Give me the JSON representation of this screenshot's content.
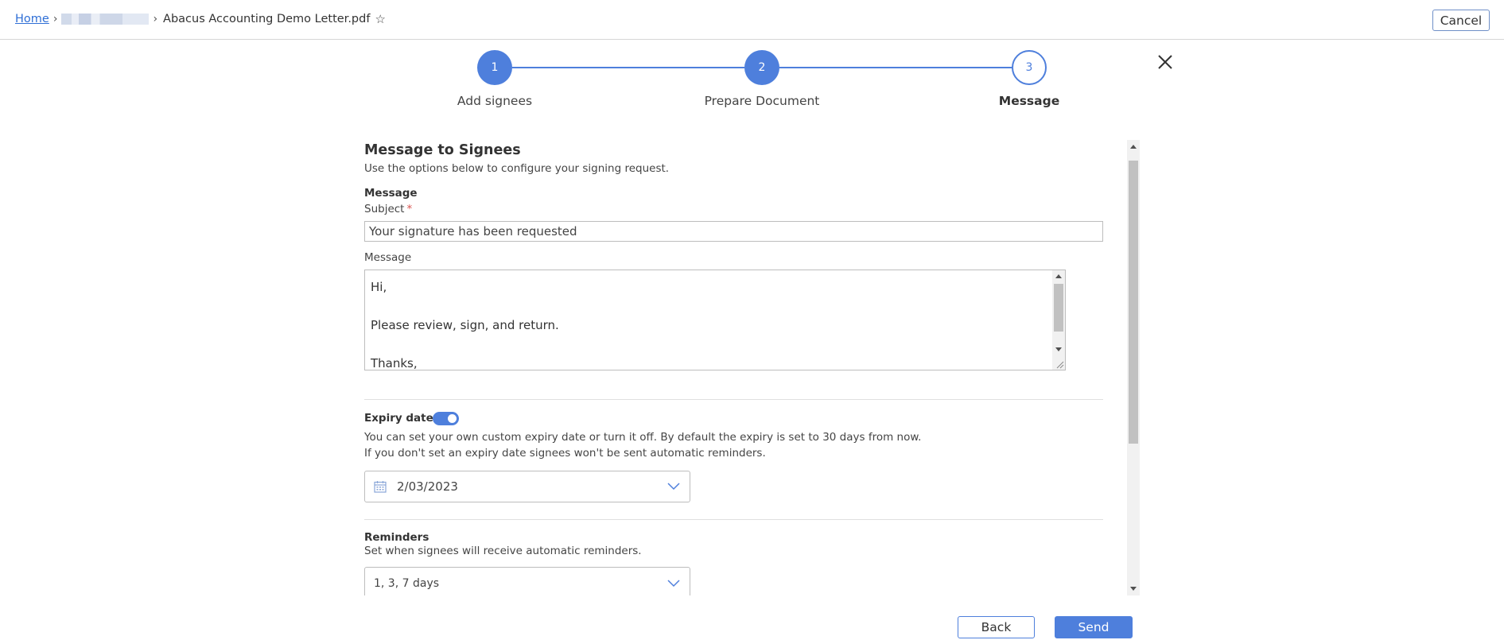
{
  "breadcrumb": {
    "home_label": "Home",
    "file_name": "Abacus Accounting Demo Letter.pdf"
  },
  "header": {
    "cancel_label": "Cancel"
  },
  "stepper": {
    "steps": [
      {
        "number": "1",
        "label": "Add signees"
      },
      {
        "number": "2",
        "label": "Prepare Document"
      },
      {
        "number": "3",
        "label": "Message"
      }
    ]
  },
  "form": {
    "title": "Message to Signees",
    "subtitle": "Use the options below to configure your signing request.",
    "message_section_label": "Message",
    "subject_label": "Subject",
    "required_marker": "*",
    "subject_value": "Your signature has been requested",
    "message_label": "Message",
    "message_lines": [
      "Hi,",
      "",
      "Please review, sign, and return.",
      "",
      "Thanks,"
    ],
    "expiry": {
      "label": "Expiry date",
      "enabled": true,
      "help_line1": "You can set your own custom expiry date or turn it off. By default the expiry is set to 30 days from now.",
      "help_line2": "If you don't set an expiry date signees won't be sent automatic reminders.",
      "date_value": "2/03/2023"
    },
    "reminders": {
      "label": "Reminders",
      "help": "Set when signees will receive automatic reminders.",
      "value": "1, 3, 7 days"
    }
  },
  "footer": {
    "back_label": "Back",
    "send_label": "Send"
  },
  "colors": {
    "accent": "#4e7fdc",
    "link": "#2f6fd6"
  }
}
